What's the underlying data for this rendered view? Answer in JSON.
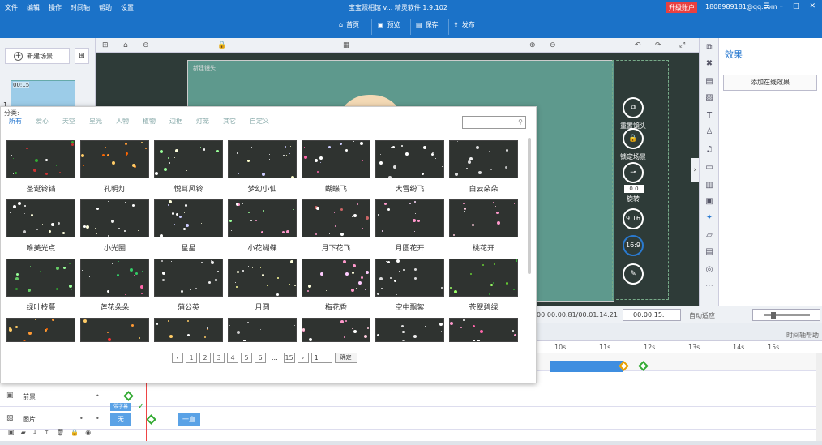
{
  "titlebar": {
    "menu": [
      "文件",
      "编辑",
      "操作",
      "时间轴",
      "帮助",
      "设置"
    ],
    "title": "宝宝照相馆 v...  精灵软件 1.9.102",
    "upgrade": "升级账户",
    "account": "1808989181@qq.com",
    "win": [
      "☰",
      "–",
      "□",
      "✕"
    ]
  },
  "toolbar": {
    "home": "首页",
    "preview": "预览",
    "save": "保存",
    "publish": "发布"
  },
  "left": {
    "new_scene": "新建场景",
    "scene_time": "00:15",
    "scene_num": "1"
  },
  "stage": {
    "label": "新建镜头"
  },
  "stage_controls": {
    "lens": "重置镜头",
    "lock": "锁定场景",
    "rotate": "旋转",
    "rotate_val": "0.0",
    "ratio1": "9:16",
    "ratio2": "16:9"
  },
  "effects": {
    "title": "效果",
    "add_online": "添加在线效果"
  },
  "timing": {
    "time": "00:00:00.81/00:01:14.21",
    "duration": "00:00:15.",
    "auto": "自动适应",
    "help": "时间轴帮助"
  },
  "ruler": [
    "10s",
    "11s",
    "12s",
    "13s",
    "14s",
    "15s"
  ],
  "tracks": [
    {
      "name": "前景",
      "icon": "前"
    },
    {
      "name": "图片",
      "icon": "图"
    }
  ],
  "clips": {
    "none1": "带字幕",
    "none2": "无",
    "always": "一直"
  },
  "dialog": {
    "category_label": "分类:",
    "categories": [
      "所有",
      "爱心",
      "天空",
      "星光",
      "人物",
      "植物",
      "边框",
      "灯笼",
      "其它",
      "自定义"
    ],
    "items": [
      "圣诞铃铛",
      "孔明灯",
      "悦耳风铃",
      "梦幻小仙",
      "蝴蝶飞",
      "大雪纷飞",
      "白云朵朵",
      "唯美光点",
      "小光圈",
      "星星",
      "小花蝴蝶",
      "月下花飞",
      "月圆花开",
      "桃花开",
      "绿叶枝蔓",
      "莲花朵朵",
      "蒲公英",
      "月圆",
      "梅花香",
      "空中飘絮",
      "苍翠碧绿",
      "",
      "",
      "",
      "",
      "",
      "",
      ""
    ],
    "pager": [
      "1",
      "2",
      "3",
      "4",
      "5",
      "6"
    ],
    "last_page": "15",
    "page_input": "1",
    "confirm": "确定"
  }
}
